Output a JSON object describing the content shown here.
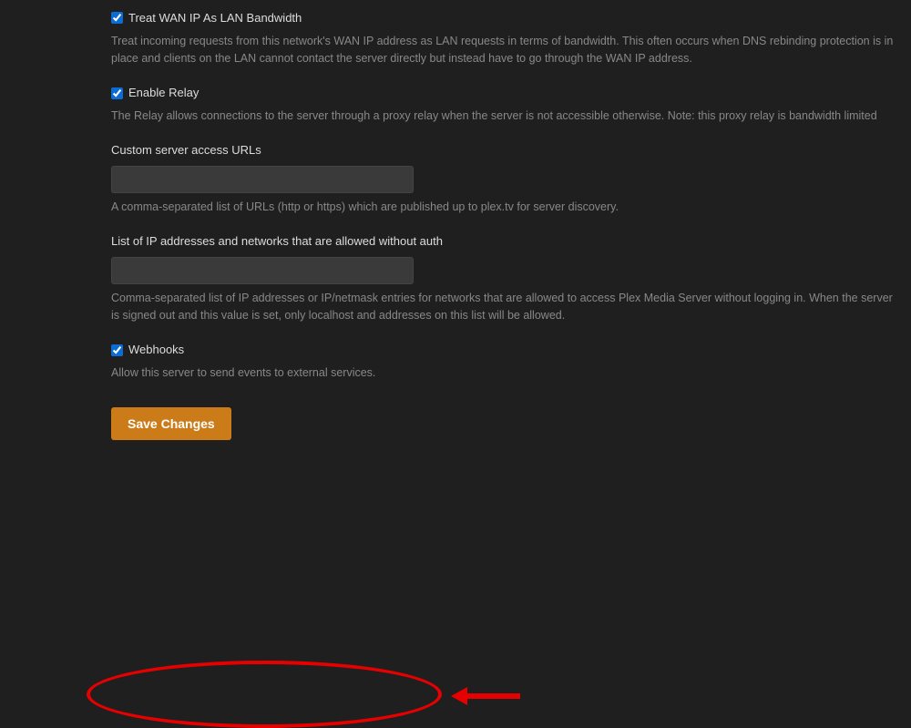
{
  "sections": {
    "wan": {
      "label": "Treat WAN IP As LAN Bandwidth",
      "desc": "Treat incoming requests from this network's WAN IP address as LAN requests in terms of bandwidth. This often occurs when DNS rebinding protection is in place and clients on the LAN cannot contact the server directly but instead have to go through the WAN IP address."
    },
    "relay": {
      "label": "Enable Relay",
      "desc": "The Relay allows connections to the server through a proxy relay when the server is not accessible otherwise. Note: this proxy relay is bandwidth limited"
    },
    "custom_urls": {
      "label": "Custom server access URLs",
      "value": "",
      "desc": "A comma-separated list of URLs (http or https) which are published up to plex.tv for server discovery."
    },
    "allowed_ips": {
      "label": "List of IP addresses and networks that are allowed without auth",
      "value": "",
      "desc": "Comma-separated list of IP addresses or IP/netmask entries for networks that are allowed to access Plex Media Server without logging in. When the server is signed out and this value is set, only localhost and addresses on this list will be allowed."
    },
    "webhooks": {
      "label": "Webhooks",
      "desc": "Allow this server to send events to external services."
    }
  },
  "save_button": "Save Changes",
  "colors": {
    "accent": "#cc7b19",
    "annotation": "#e60000"
  }
}
